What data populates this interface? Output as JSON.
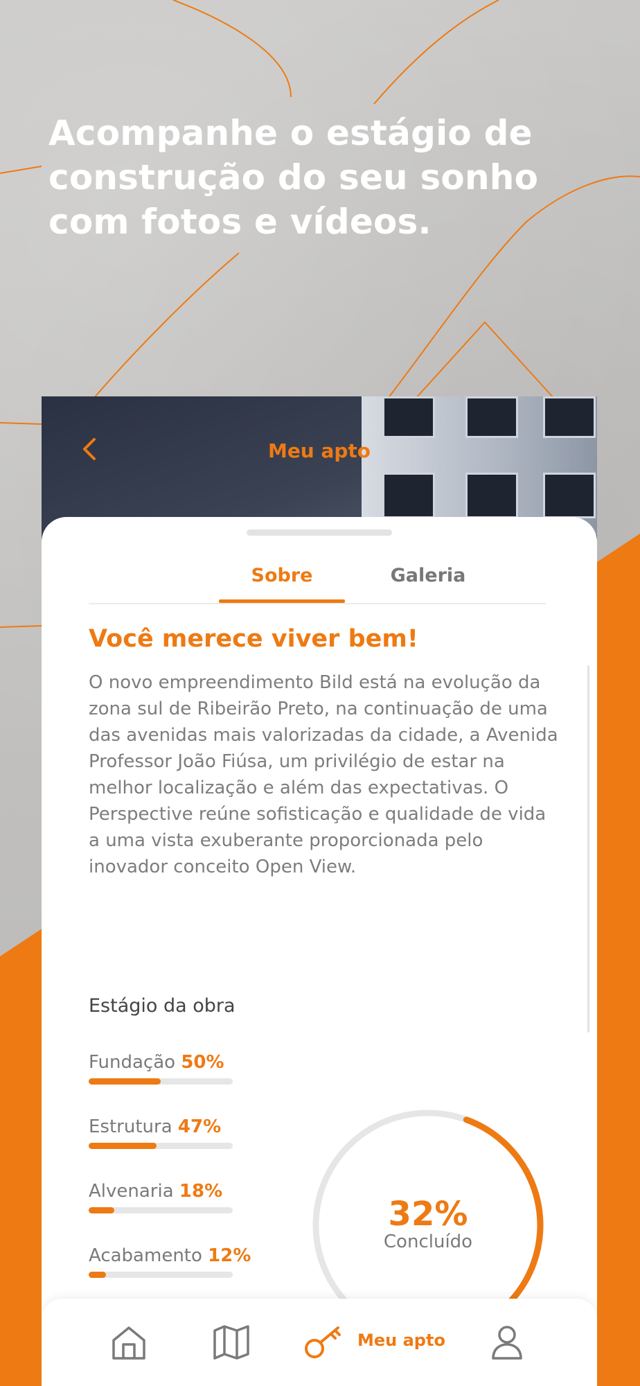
{
  "colors": {
    "accent": "#ee7a13",
    "text_gray": "#7d7d7d",
    "track": "#e6e6e6"
  },
  "promo": {
    "headline_lines": [
      "Acompanhe o estágio de",
      "construção do seu sonho",
      "com fotos e vídeos."
    ]
  },
  "header": {
    "title": "Meu apto",
    "back_icon": "chevron-left-icon"
  },
  "tabs": [
    {
      "label": "Sobre",
      "active": true
    },
    {
      "label": "Galeria",
      "active": false
    }
  ],
  "about": {
    "title": "Você merece viver bem!",
    "description": "O novo empreendimento Bild está na evolução da zona sul de Ribeirão Preto, na continuação de uma das avenidas mais valorizadas da cidade, a Avenida Professor João Fiúsa, um privilégio de estar na melhor localização e além das expectativas. O Perspective reúne sofisticação e qualidade de vida a uma vista exuberante proporcionada pelo inovador conceito Open View."
  },
  "construction": {
    "title": "Estágio da obra",
    "stages": [
      {
        "label": "Fundação",
        "percent_text": "50%",
        "value": 50
      },
      {
        "label": "Estrutura",
        "percent_text": "47%",
        "value": 47
      },
      {
        "label": "Alvenaria",
        "percent_text": "18%",
        "value": 18
      },
      {
        "label": "Acabamento",
        "percent_text": "12%",
        "value": 12
      }
    ],
    "overall": {
      "percent_text": "32%",
      "value": 32,
      "caption": "Concluído"
    }
  },
  "nav": {
    "items": [
      {
        "icon": "home-icon"
      },
      {
        "icon": "map-icon"
      },
      {
        "icon": "key-icon",
        "label": "Meu apto",
        "active": true
      },
      {
        "icon": "user-icon"
      }
    ]
  }
}
